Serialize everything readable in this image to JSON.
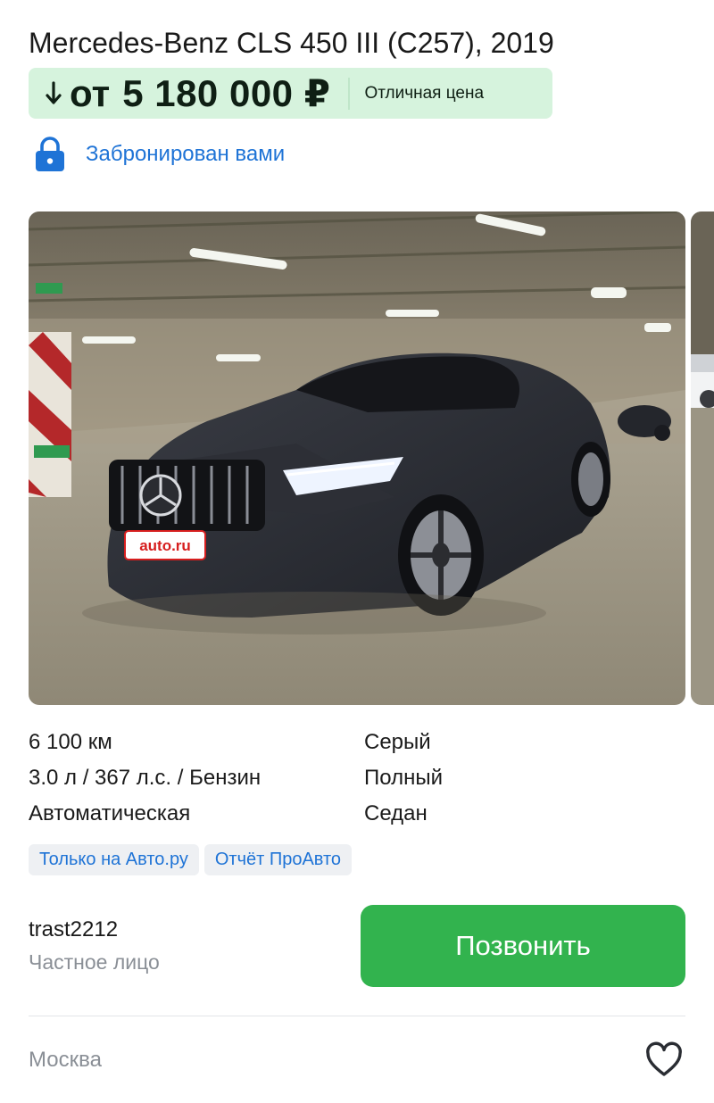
{
  "listing": {
    "title": "Mercedes-Benz CLS 450 III (C257), 2019",
    "price": {
      "prefix": "от",
      "value": "5 180 000 ₽",
      "badge": "Отличная цена",
      "trend_icon": "arrow-down-icon"
    },
    "booking": {
      "icon": "lock-icon",
      "text": "Забронирован вами"
    },
    "gallery": {
      "badge_plate": "auto.ru"
    },
    "specs": {
      "mileage": "6 100 км",
      "color": "Серый",
      "engine": "3.0 л / 367 л.с. / Бензин",
      "drive": "Полный",
      "transmission": "Автоматическая",
      "body": "Седан"
    },
    "tags": [
      "Только на Авто.ру",
      "Отчёт ПроАвто"
    ],
    "seller": {
      "name": "trast2212",
      "type": "Частное лицо"
    },
    "call_button": "Позвонить",
    "location": "Москва",
    "favorite_icon": "heart-icon"
  },
  "colors": {
    "price_bg": "#d6f3dd",
    "link_blue": "#1e73d6",
    "call_green": "#32b34e",
    "muted_gray": "#8a8f96",
    "tag_bg": "#eef0f3"
  }
}
